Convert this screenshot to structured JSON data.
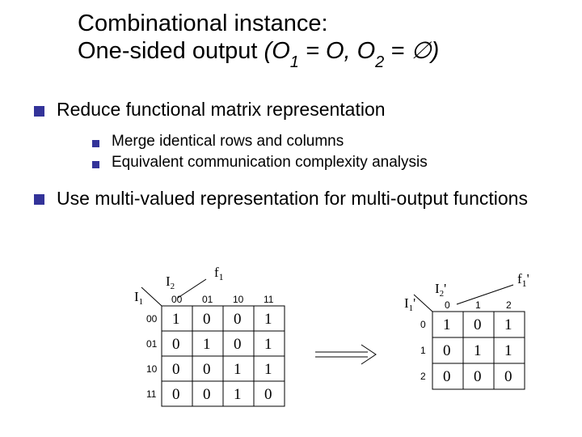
{
  "title_line1": "Combinational instance:",
  "title_line2a": "One-sided output ",
  "title_o": "(O",
  "title_sub1": "1",
  "title_eq1": " = O, O",
  "title_sub2": "2",
  "title_eq2": " = ",
  "title_empty": "∅",
  "title_close": ")",
  "b1": "Reduce functional matrix representation",
  "b1a": "Merge identical rows and columns",
  "b1b": "Equivalent communication complexity analysis",
  "b2": "Use multi-valued representation for multi-output functions",
  "left": {
    "ftop": "f",
    "ftop_sub": "1",
    "row_axis": "I",
    "row_axis_sub": "1",
    "col_axis": "I",
    "col_axis_sub": "2",
    "cols": [
      "00",
      "01",
      "10",
      "11"
    ],
    "rows": [
      "00",
      "01",
      "10",
      "11"
    ],
    "cells": [
      [
        "1",
        "0",
        "0",
        "1"
      ],
      [
        "0",
        "1",
        "0",
        "1"
      ],
      [
        "0",
        "0",
        "1",
        "1"
      ],
      [
        "0",
        "0",
        "1",
        "0"
      ]
    ]
  },
  "right": {
    "ftop": "f",
    "ftop_sub": "1",
    "ftop_prime": "'",
    "row_axis": "I",
    "row_axis_sub": "1",
    "row_axis_prime": "'",
    "col_axis": "I",
    "col_axis_sub": "2",
    "col_axis_prime": "'",
    "cols": [
      "0",
      "1",
      "2"
    ],
    "rows": [
      "0",
      "1",
      "2"
    ],
    "cells": [
      [
        "1",
        "0",
        "1"
      ],
      [
        "0",
        "1",
        "1"
      ],
      [
        "0",
        "0",
        "0"
      ]
    ]
  },
  "chart_data": [
    {
      "type": "table",
      "title": "f1 (original 4x4 functional matrix)",
      "row_label": "I1",
      "col_label": "I2",
      "categories_cols": [
        "00",
        "01",
        "10",
        "11"
      ],
      "categories_rows": [
        "00",
        "01",
        "10",
        "11"
      ],
      "values": [
        [
          1,
          0,
          0,
          1
        ],
        [
          0,
          1,
          0,
          1
        ],
        [
          0,
          0,
          1,
          1
        ],
        [
          0,
          0,
          1,
          0
        ]
      ]
    },
    {
      "type": "table",
      "title": "f1' (reduced 3x3 matrix after merging identical rows/columns)",
      "row_label": "I1'",
      "col_label": "I2'",
      "categories_cols": [
        "0",
        "1",
        "2"
      ],
      "categories_rows": [
        "0",
        "1",
        "2"
      ],
      "values": [
        [
          1,
          0,
          1
        ],
        [
          0,
          1,
          1
        ],
        [
          0,
          0,
          0
        ]
      ]
    }
  ]
}
